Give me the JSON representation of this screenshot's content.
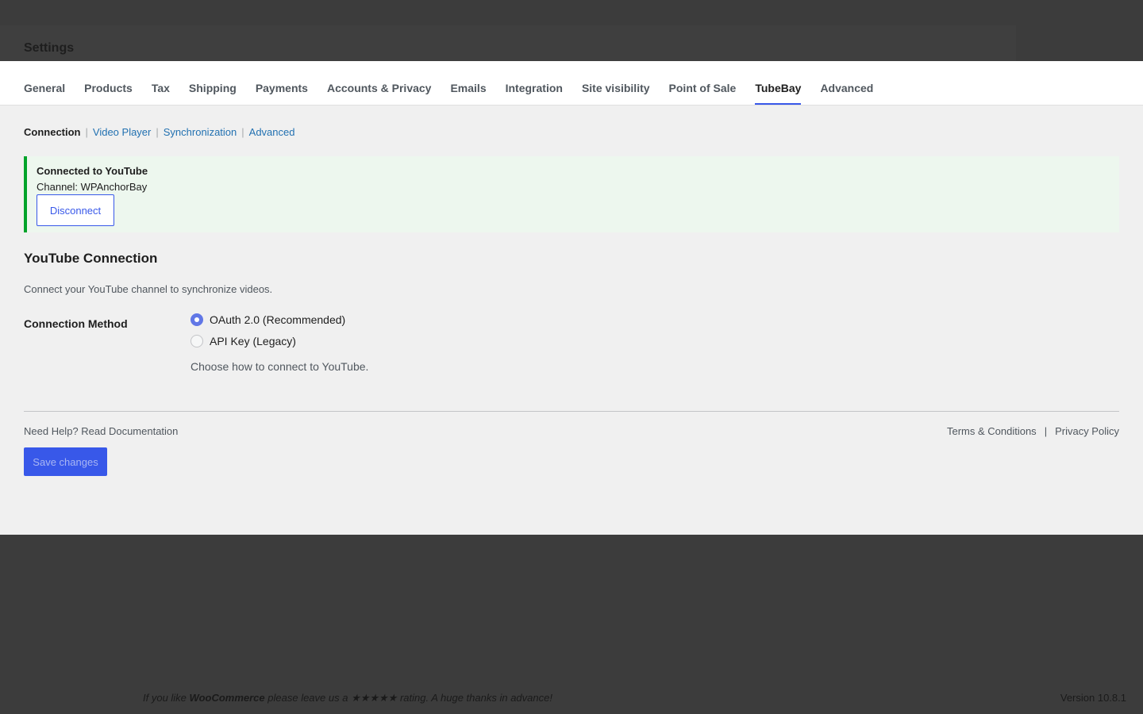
{
  "header": {
    "title": "Settings"
  },
  "tabs": [
    {
      "label": "General",
      "active": false
    },
    {
      "label": "Products",
      "active": false
    },
    {
      "label": "Tax",
      "active": false
    },
    {
      "label": "Shipping",
      "active": false
    },
    {
      "label": "Payments",
      "active": false
    },
    {
      "label": "Accounts & Privacy",
      "active": false
    },
    {
      "label": "Emails",
      "active": false
    },
    {
      "label": "Integration",
      "active": false
    },
    {
      "label": "Site visibility",
      "active": false
    },
    {
      "label": "Point of Sale",
      "active": false
    },
    {
      "label": "TubeBay",
      "active": true
    },
    {
      "label": "Advanced",
      "active": false
    }
  ],
  "subnav": {
    "items": [
      "Connection",
      "Video Player",
      "Synchronization",
      "Advanced"
    ],
    "separator": "|",
    "current": "Connection"
  },
  "notice": {
    "title": "Connected to YouTube",
    "channel": "Channel: WPAnchorBay",
    "disconnect_label": "Disconnect"
  },
  "section": {
    "title": "YouTube Connection",
    "description": "Connect your YouTube channel to synchronize videos."
  },
  "connection_method": {
    "label": "Connection Method",
    "options": [
      {
        "label": "OAuth 2.0 (Recommended)",
        "checked": true
      },
      {
        "label": "API Key (Legacy)",
        "checked": false
      }
    ],
    "help": "Choose how to connect to YouTube."
  },
  "footer": {
    "help_link": "Need Help? Read Documentation",
    "terms": "Terms & Conditions",
    "pipe": "|",
    "privacy": "Privacy Policy",
    "save_label": "Save changes"
  },
  "admin_footer": {
    "rate_prefix": "If you like ",
    "rate_brand": "WooCommerce",
    "rate_middle": " please leave us a ",
    "rate_stars": "★★★★★",
    "rate_suffix": " rating. A huge thanks in advance!",
    "version": "Version 10.8.1"
  },
  "colors": {
    "accent": "#3858e9",
    "link": "#2271b1",
    "success_border": "#00a32a",
    "success_bg": "#edf7ee",
    "backdrop": "#3c3c3c"
  }
}
